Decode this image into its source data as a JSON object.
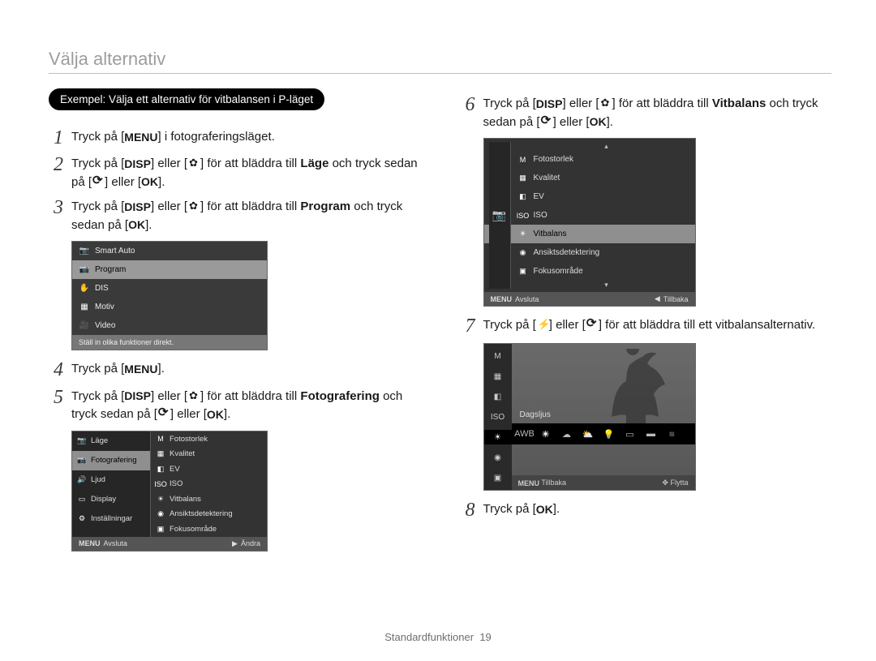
{
  "section_title": "Välja alternativ",
  "example_label": "Exempel: Välja ett alternativ för vitbalansen i P-läget",
  "labels": {
    "menu": "MENU",
    "disp": "DISP",
    "ok": "OK"
  },
  "steps": {
    "s1": {
      "num": "1",
      "a": "Tryck på [",
      "b": "] i fotograferingsläget."
    },
    "s2": {
      "num": "2",
      "a": "Tryck på [",
      "b": "] eller [",
      "c": "] för att bläddra till ",
      "target": "Läge",
      "d": " och tryck sedan på [",
      "e": "] eller [",
      "f": "]."
    },
    "s3": {
      "num": "3",
      "a": "Tryck på [",
      "b": "] eller [",
      "c": "] för att bläddra till ",
      "target": "Program",
      "d": " och tryck sedan på [",
      "e": "]."
    },
    "s4": {
      "num": "4",
      "a": "Tryck på [",
      "b": "]."
    },
    "s5": {
      "num": "5",
      "a": "Tryck på [",
      "b": "] eller [",
      "c": "] för att bläddra till ",
      "target": "Fotografering",
      "d": " och tryck sedan på [",
      "e": "] eller [",
      "f": "]."
    },
    "s6": {
      "num": "6",
      "a": "Tryck på [",
      "b": "] eller [",
      "c": "] för att bläddra till ",
      "target": "Vitbalans",
      "d": " och tryck sedan på [",
      "e": "] eller [",
      "f": "]."
    },
    "s7": {
      "num": "7",
      "a": "Tryck på [",
      "b": "] eller [",
      "c": "] för att bläddra till ett vitbalansalternativ."
    },
    "s8": {
      "num": "8",
      "a": "Tryck på [",
      "b": "]."
    }
  },
  "panel1": {
    "items": [
      "Smart Auto",
      "Program",
      "DIS",
      "Motiv",
      "Video"
    ],
    "selected_index": 1,
    "hint": "Ställ in olika funktioner direkt."
  },
  "panel2": {
    "left": [
      "Läge",
      "Fotografering",
      "Ljud",
      "Display",
      "Inställningar"
    ],
    "left_selected_index": 1,
    "right": [
      "Fotostorlek",
      "Kvalitet",
      "EV",
      "ISO",
      "Vitbalans",
      "Ansiktsdetektering",
      "Fokusområde"
    ],
    "footer_left": "Avsluta",
    "footer_left_btn": "MENU",
    "footer_right": "Ändra",
    "footer_right_btn": "▶"
  },
  "panel3": {
    "items": [
      "Fotostorlek",
      "Kvalitet",
      "EV",
      "ISO",
      "Vitbalans",
      "Ansiktsdetektering",
      "Fokusområde"
    ],
    "selected_index": 4,
    "footer_left": "Avsluta",
    "footer_left_btn": "MENU",
    "footer_right": "Tillbaka",
    "footer_right_btn": "◀"
  },
  "panel4": {
    "label": "Dagsljus",
    "left_icons": [
      "M",
      "▦",
      "◧",
      "ISO",
      "☀",
      "◉",
      "▣"
    ],
    "wb_icons": [
      "AWB",
      "☀",
      "☁",
      "⛅",
      "💡",
      "▭",
      "▬",
      "◾"
    ],
    "wb_selected_index": 1,
    "footer_left": "Tillbaka",
    "footer_left_btn": "MENU",
    "footer_right": "Flytta",
    "footer_right_btn": "✥"
  },
  "page_footer": {
    "label": "Standardfunktioner",
    "num": "19"
  }
}
